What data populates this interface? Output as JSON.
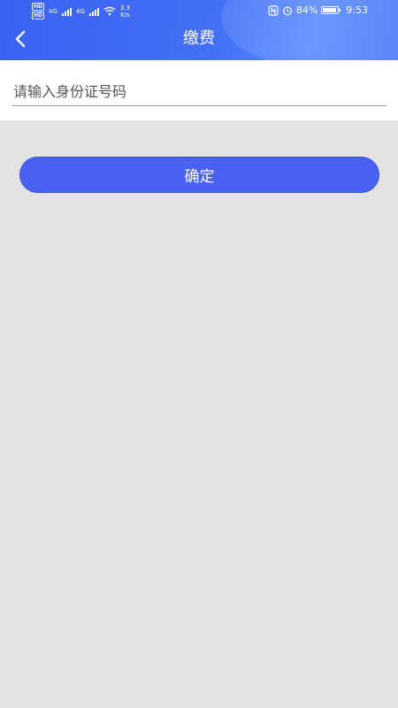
{
  "status_bar": {
    "network_left": "4G",
    "network_right": "4G",
    "speed_value": "3.3",
    "speed_unit": "K/s",
    "battery": "84%",
    "time": "9:53"
  },
  "header": {
    "title": "缴费"
  },
  "form": {
    "id_number_placeholder": "请输入身份证号码",
    "id_number_value": ""
  },
  "actions": {
    "confirm_label": "确定"
  },
  "colors": {
    "primary": "#4a62f2",
    "background": "#e3e3e3"
  }
}
